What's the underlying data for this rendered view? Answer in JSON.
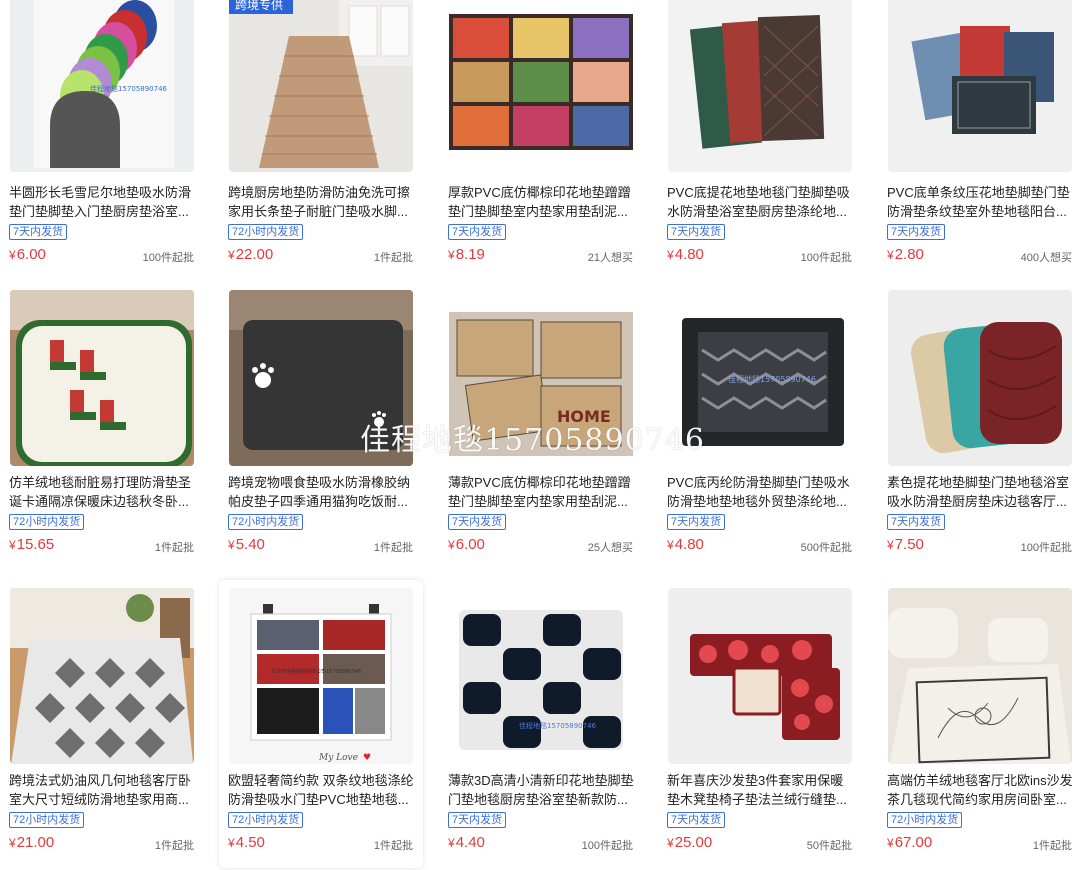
{
  "products": [
    {
      "title": "半圆形长毛雪尼尔地垫吸水防滑垫门垫脚垫入门垫厨房垫浴室...",
      "badge": "7天内发货",
      "currency": "¥",
      "price": "6.00",
      "moq": "100件起批",
      "image": "semicircle-chenille-mats-photo"
    },
    {
      "title": "跨境厨房地垫防滑防油免洗可擦家用长条垫子耐脏门垫吸水脚...",
      "badge": "72小时内发货",
      "currency": "¥",
      "price": "22.00",
      "moq": "1件起批",
      "image": "kitchen-runner-mat-photo",
      "image_tag": "跨境专供"
    },
    {
      "title": "厚款PVC底仿椰棕印花地垫蹭蹭垫门垫脚垫室内垫家用垫刮泥...",
      "badge": "7天内发货",
      "currency": "¥",
      "price": "8.19",
      "moq": "21人想买",
      "image": "printed-coir-doormats-photo"
    },
    {
      "title": "PVC底提花地垫地毯门垫脚垫吸水防滑垫浴室垫厨房垫涤纶地...",
      "badge": "7天内发货",
      "currency": "¥",
      "price": "4.80",
      "moq": "100件起批",
      "image": "jacquard-doormats-photo"
    },
    {
      "title": "PVC底单条纹压花地垫脚垫门垫防滑垫条纹垫室外垫地毯阳台...",
      "badge": "7天内发货",
      "currency": "¥",
      "price": "2.80",
      "moq": "400人想买",
      "image": "embossed-doormats-photo"
    },
    {
      "title": "仿羊绒地毯耐脏易打理防滑垫圣诞卡通隔凉保暖床边毯秋冬卧...",
      "badge": "72小时内发货",
      "currency": "¥",
      "price": "15.65",
      "moq": "1件起批",
      "image": "christmas-bedside-rug-photo"
    },
    {
      "title": "跨境宠物喂食垫吸水防滑橡胶纳帕皮垫子四季通用猫狗吃饭耐...",
      "badge": "72小时内发货",
      "currency": "¥",
      "price": "5.40",
      "moq": "1件起批",
      "image": "pet-feeding-mat-photo"
    },
    {
      "title": "薄款PVC底仿椰棕印花地垫蹭蹭垫门垫脚垫室内垫家用垫刮泥...",
      "badge": "7天内发货",
      "currency": "¥",
      "price": "6.00",
      "moq": "25人想买",
      "image": "thin-coir-doormats-photo"
    },
    {
      "title": "PVC底丙纶防滑垫脚垫门垫吸水防滑垫地垫地毯外贸垫涤纶地...",
      "badge": "7天内发货",
      "currency": "¥",
      "price": "4.80",
      "moq": "500件起批",
      "image": "ribbed-doormat-photo",
      "image_tag": "佳程地毯15705890746"
    },
    {
      "title": "素色提花地垫脚垫门垫地毯浴室吸水防滑垫厨房垫床边毯客厅...",
      "badge": "7天内发货",
      "currency": "¥",
      "price": "7.50",
      "moq": "100件起批",
      "image": "solid-bath-mats-photo"
    },
    {
      "title": "跨境法式奶油风几何地毯客厅卧室大尺寸短绒防滑地垫家用商...",
      "badge": "72小时内发货",
      "currency": "¥",
      "price": "21.00",
      "moq": "1件起批",
      "image": "geometric-living-room-rug-photo"
    },
    {
      "title": "欧盟轻奢简约款 双条纹地毯涤纶防滑垫吸水门垫PVC地垫地毯...",
      "badge": "72小时内发货",
      "currency": "¥",
      "price": "4.50",
      "moq": "1件起批",
      "image": "sample-board-photo",
      "image_tag": "义乌市佳程地毯有限公司15705890746",
      "image_caption": "My Love"
    },
    {
      "title": "薄款3D高清小清新印花地垫脚垫门垫地毯厨房垫浴室垫新款防...",
      "badge": "7天内发货",
      "currency": "¥",
      "price": "4.40",
      "moq": "100件起批",
      "image": "3d-checker-mat-photo",
      "image_tag": "佳程地毯15705890746"
    },
    {
      "title": "新年喜庆沙发垫3件套家用保暖垫木凳垫椅子垫法兰绒行缝垫...",
      "badge": "7天内发货",
      "currency": "¥",
      "price": "25.00",
      "moq": "50件起批",
      "image": "rose-sofa-cushion-set-photo"
    },
    {
      "title": "高端仿羊绒地毯客厅北欧ins沙发茶几毯现代简约家用房间卧室...",
      "badge": "72小时内发货",
      "currency": "¥",
      "price": "67.00",
      "moq": "1件起批",
      "image": "floral-line-rug-photo"
    }
  ],
  "watermark": "佳程地毯15705890746",
  "colors": {
    "price": "#e4393c",
    "badge": "#3b6fd6"
  }
}
